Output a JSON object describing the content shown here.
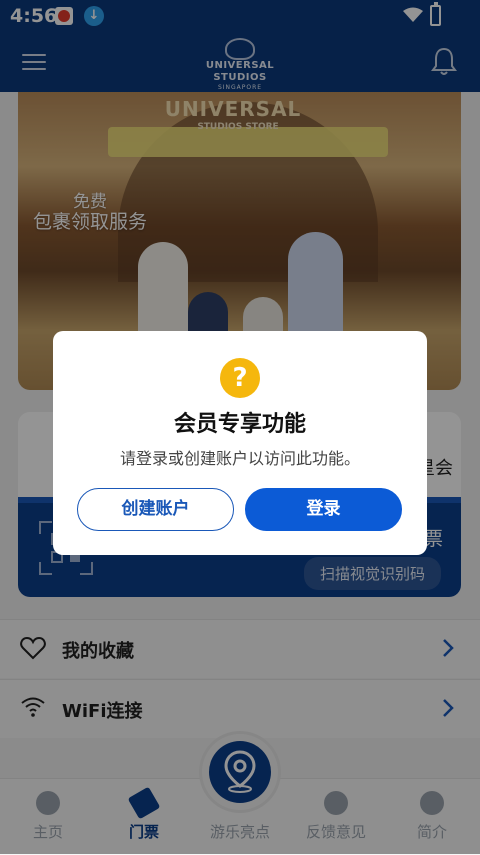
{
  "status_bar": {
    "time": "4:56"
  },
  "header": {
    "logo_brand": "UNIVERSAL STUDIOS",
    "logo_sub": "SINGAPORE"
  },
  "banner": {
    "sign_text": "UNIVERSAL",
    "store_text": "STUDIOS STORE",
    "promo_line1": "免费",
    "promo_line2": "包裹领取服务"
  },
  "member_card": {
    "member_text": "星会",
    "ticket_text": "票",
    "scan_button": "扫描视觉识别码"
  },
  "list": [
    {
      "label": "我的收藏"
    },
    {
      "label": "WiFi连接"
    }
  ],
  "bottom_nav": [
    {
      "label": "主页"
    },
    {
      "label": "门票"
    },
    {
      "label": "游乐亮点"
    },
    {
      "label": "反馈意见"
    },
    {
      "label": "简介"
    }
  ],
  "dialog": {
    "icon_glyph": "?",
    "title": "会员专享功能",
    "message": "请登录或创建账户以访问此功能。",
    "create_button": "创建账户",
    "login_button": "登录"
  },
  "colors": {
    "header_bg": "#0b3a7d",
    "accent": "#0c5bd6",
    "warning": "#f5b70d"
  }
}
